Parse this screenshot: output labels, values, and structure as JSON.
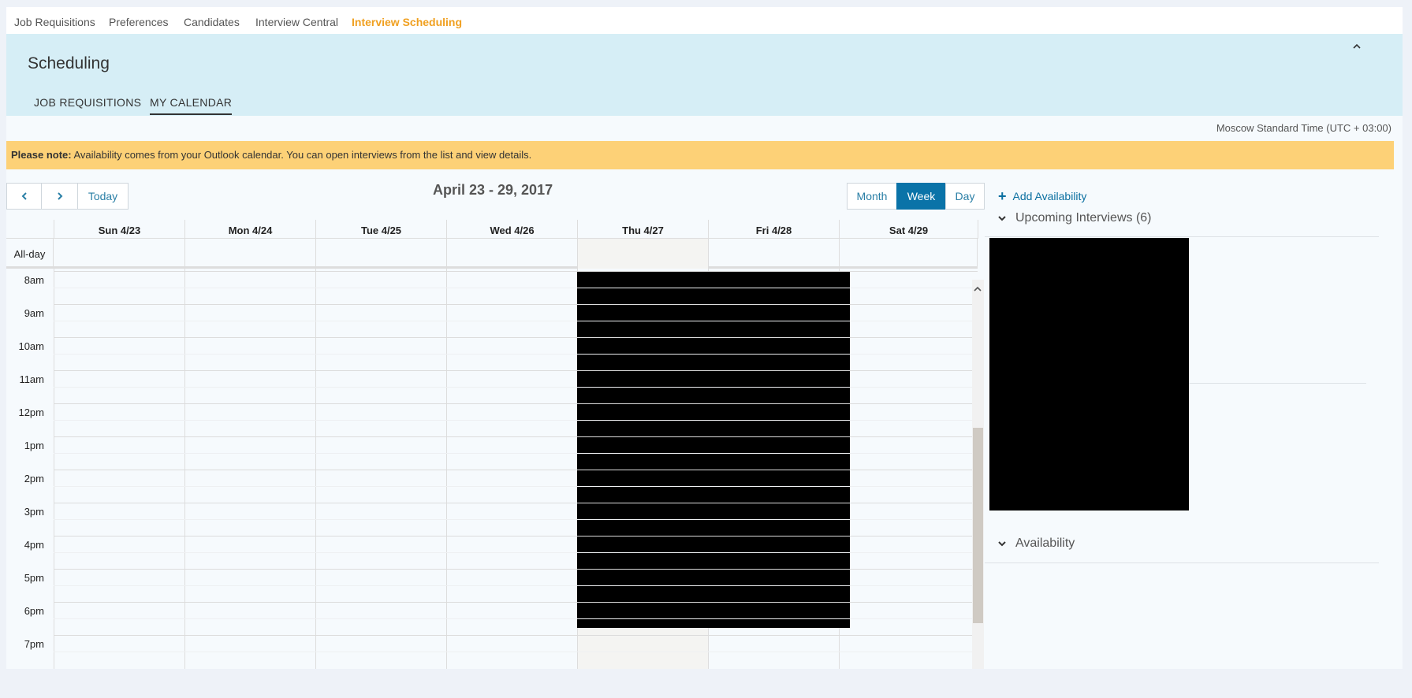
{
  "topnav": {
    "items": [
      {
        "label": "Job Requisitions"
      },
      {
        "label": "Preferences"
      },
      {
        "label": "Candidates"
      },
      {
        "label": "Interview Central"
      },
      {
        "label": "Interview Scheduling"
      }
    ],
    "active_index": 4
  },
  "header": {
    "title": "Scheduling",
    "collapse_icon": "chevron-up-icon",
    "subtabs": [
      {
        "label": "JOB REQUISITIONS"
      },
      {
        "label": "MY CALENDAR"
      }
    ],
    "active_subtab": 1
  },
  "timezone": "Moscow Standard Time (UTC + 03:00)",
  "notice": {
    "bold": "Please note:",
    "text": " Availability comes from your Outlook calendar. You can open interviews from the list and view details."
  },
  "toolbar": {
    "prev_icon": "chevron-left-icon",
    "next_icon": "chevron-right-icon",
    "today_label": "Today",
    "range_label": "April 23 - 29, 2017",
    "views": [
      "Month",
      "Week",
      "Day"
    ],
    "active_view": "Week"
  },
  "calendar": {
    "allday_label": "All-day",
    "days": [
      "Sun 4/23",
      "Mon 4/24",
      "Tue 4/25",
      "Wed 4/26",
      "Thu 4/27",
      "Fri 4/28",
      "Sat 4/29"
    ],
    "today_index": 4,
    "hours": [
      "8am",
      "9am",
      "10am",
      "11am",
      "12pm",
      "1pm",
      "2pm",
      "3pm",
      "4pm",
      "5pm",
      "6pm",
      "7pm"
    ]
  },
  "right_panel": {
    "add_availability": "Add Availability",
    "upcoming_label": "Upcoming Interviews (6)",
    "availability_label": "Availability"
  },
  "colors": {
    "accent": "#0a73a8",
    "nav_active": "#f0a020",
    "header_bg": "#d6eef6",
    "notice_bg": "#fdd177"
  }
}
